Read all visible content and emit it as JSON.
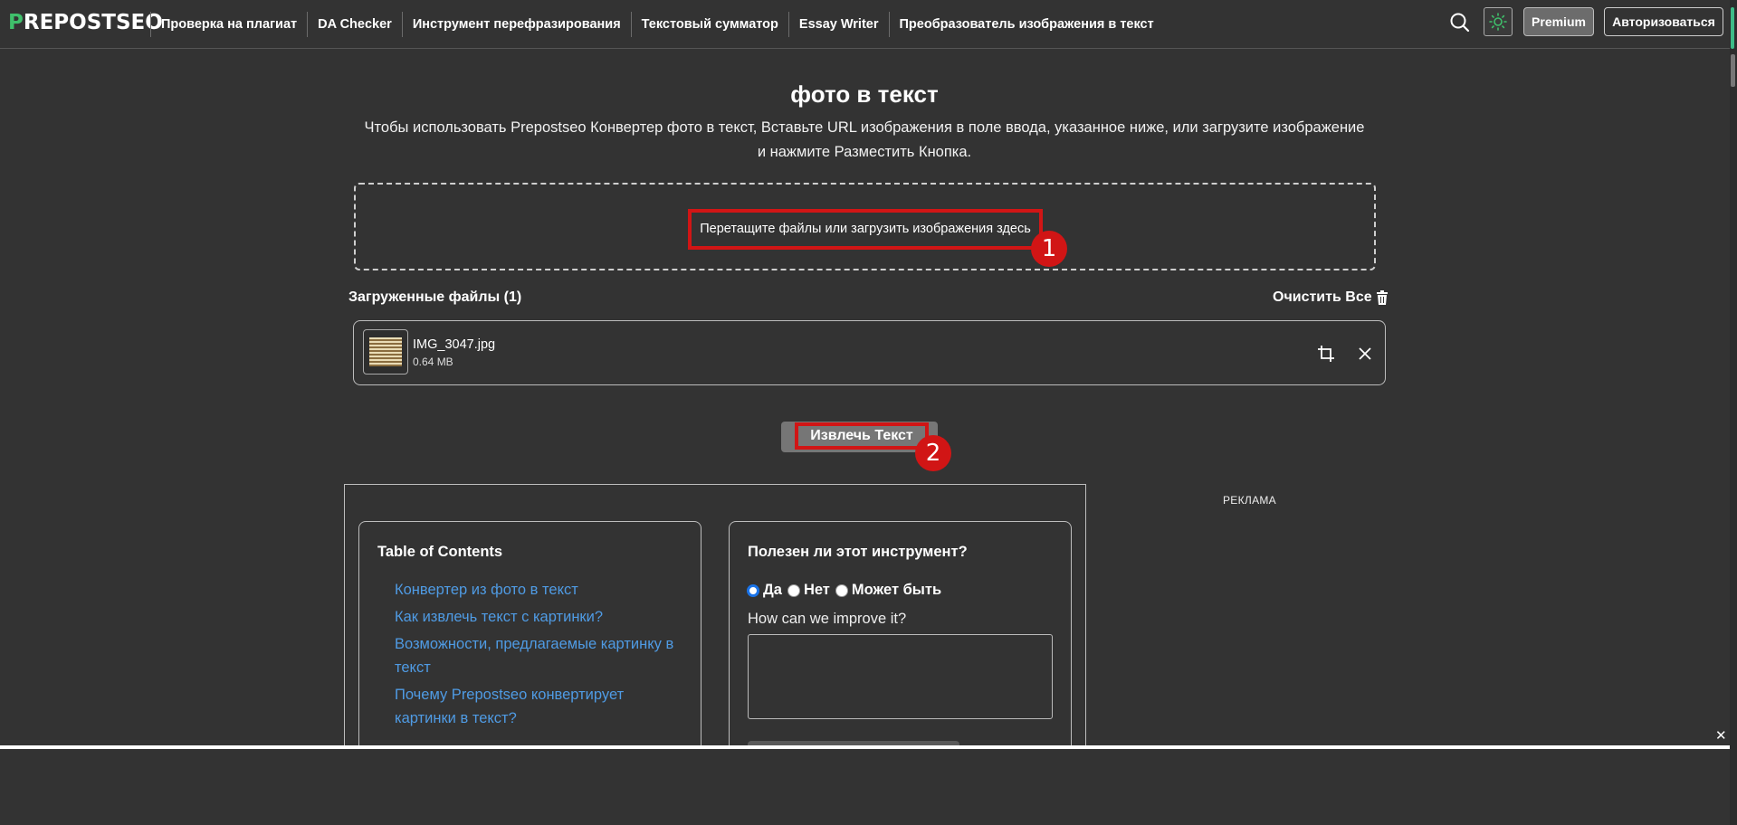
{
  "header": {
    "logo_text": "REPOSTSEO",
    "logo_mark": "P",
    "nav": [
      {
        "label": "Проверка на плагиат"
      },
      {
        "label": "DA Checker"
      },
      {
        "label": "Инструмент перефразирования"
      },
      {
        "label": "Текстовый сумматор"
      },
      {
        "label": "Essay Writer"
      },
      {
        "label": "Преобразователь изображения в текст"
      }
    ],
    "premium_label": "Premium",
    "login_label": "Авторизоваться",
    "icons": {
      "search": "search-icon",
      "theme": "sun-icon"
    },
    "accent_color": "#3fbf6b"
  },
  "hero": {
    "title": "фото в текст",
    "subtitle": "Чтобы использовать Prepostseo Конвертер фото в текст, Вставьте URL изображения в поле ввода, указанное ниже, или загрузите изображение и нажмите Разместить Кнопка."
  },
  "upload": {
    "drop_text": "Перетащите файлы или загрузить изображения здесь",
    "badge_1": "1",
    "uploaded_label": "Загруженные файлы (1)",
    "clear_all_label": "Очистить Все",
    "file": {
      "name": "IMG_3047.jpg",
      "size": "0.64 MB"
    },
    "icons": {
      "trash": "trash-icon",
      "crop": "crop-icon",
      "remove": "close-icon"
    }
  },
  "extract": {
    "label": "Извлечь Текст",
    "badge_2": "2",
    "annotation_color": "#d11515"
  },
  "toc": {
    "title": "Table of Contents",
    "items": [
      {
        "label": "Конвертер из фото в текст"
      },
      {
        "label": "Как извлечь текст с картинки?"
      },
      {
        "label": "Возможности, предлагаемые картинку в текст"
      },
      {
        "label": "Почему Prepostseo конвертирует картинки в текст?"
      }
    ],
    "link_color": "#4f9be4"
  },
  "feedback": {
    "title": "Полезен ли этот инструмент?",
    "options": [
      {
        "label": "Да",
        "checked": true
      },
      {
        "label": "Нет",
        "checked": false
      },
      {
        "label": "Может быть",
        "checked": false
      }
    ],
    "question": "How can we improve it?"
  },
  "ad": {
    "label": "РЕКЛАМА"
  },
  "overlay": {
    "close_label": "✕"
  }
}
